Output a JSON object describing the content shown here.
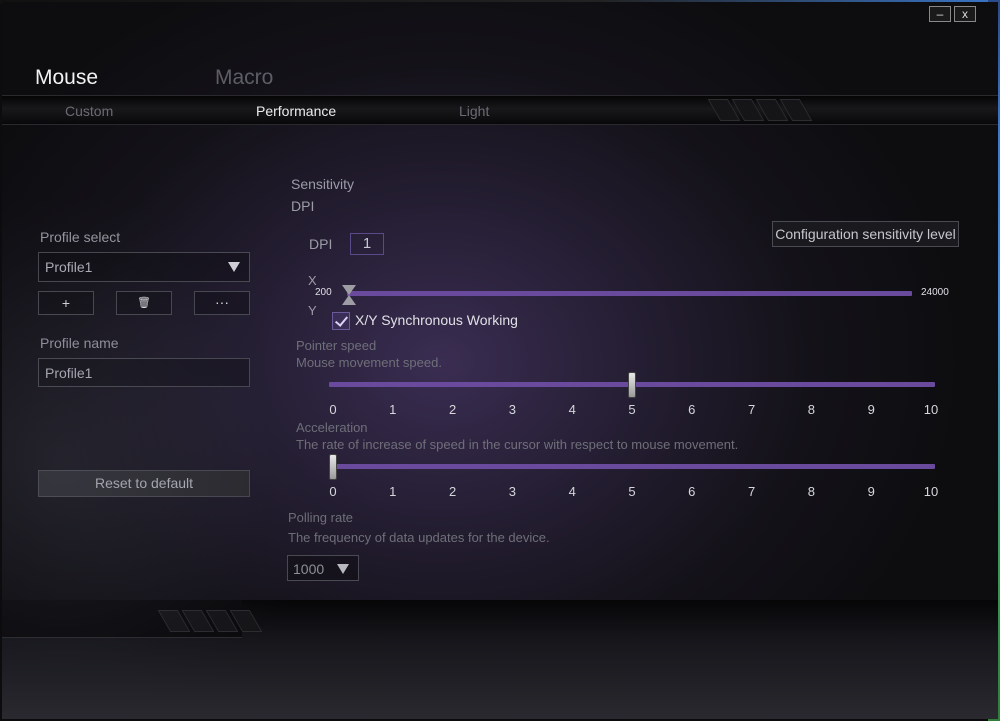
{
  "window": {
    "minimize": "–",
    "close": "x"
  },
  "main_tabs": [
    {
      "label": "Mouse"
    },
    {
      "label": "Macro"
    }
  ],
  "sub_tabs": [
    {
      "label": "Custom"
    },
    {
      "label": "Performance"
    },
    {
      "label": "Light"
    }
  ],
  "profile": {
    "select_label": "Profile select",
    "selected": "Profile1",
    "add_label": "+",
    "delete_label": "🗑",
    "more_label": "···",
    "name_label": "Profile name",
    "name_value": "Profile1",
    "reset_label": "Reset to default"
  },
  "sensitivity": {
    "title": "Sensitivity",
    "dpi_heading": "DPI",
    "dpi_label": "DPI",
    "dpi_level": "1",
    "config_button": "Configuration sensitivity level",
    "x_label": "X",
    "y_label": "Y",
    "min_label": "200",
    "max_label": "24000",
    "dpi_value": 200,
    "sync_label": "X/Y Synchronous Working",
    "sync_checked": true
  },
  "pointer_speed": {
    "title": "Pointer speed",
    "description": "Mouse movement speed.",
    "value": 5,
    "ticks": [
      "0",
      "1",
      "2",
      "3",
      "4",
      "5",
      "6",
      "7",
      "8",
      "9",
      "10"
    ]
  },
  "acceleration": {
    "title": "Acceleration",
    "description": "The rate of increase of speed in the cursor with respect to mouse movement.",
    "value": 0,
    "ticks": [
      "0",
      "1",
      "2",
      "3",
      "4",
      "5",
      "6",
      "7",
      "8",
      "9",
      "10"
    ]
  },
  "polling": {
    "title": "Polling rate",
    "description": "The frequency of data updates for the device.",
    "selected": "1000"
  },
  "colors": {
    "accent": "#6a4a9c"
  }
}
